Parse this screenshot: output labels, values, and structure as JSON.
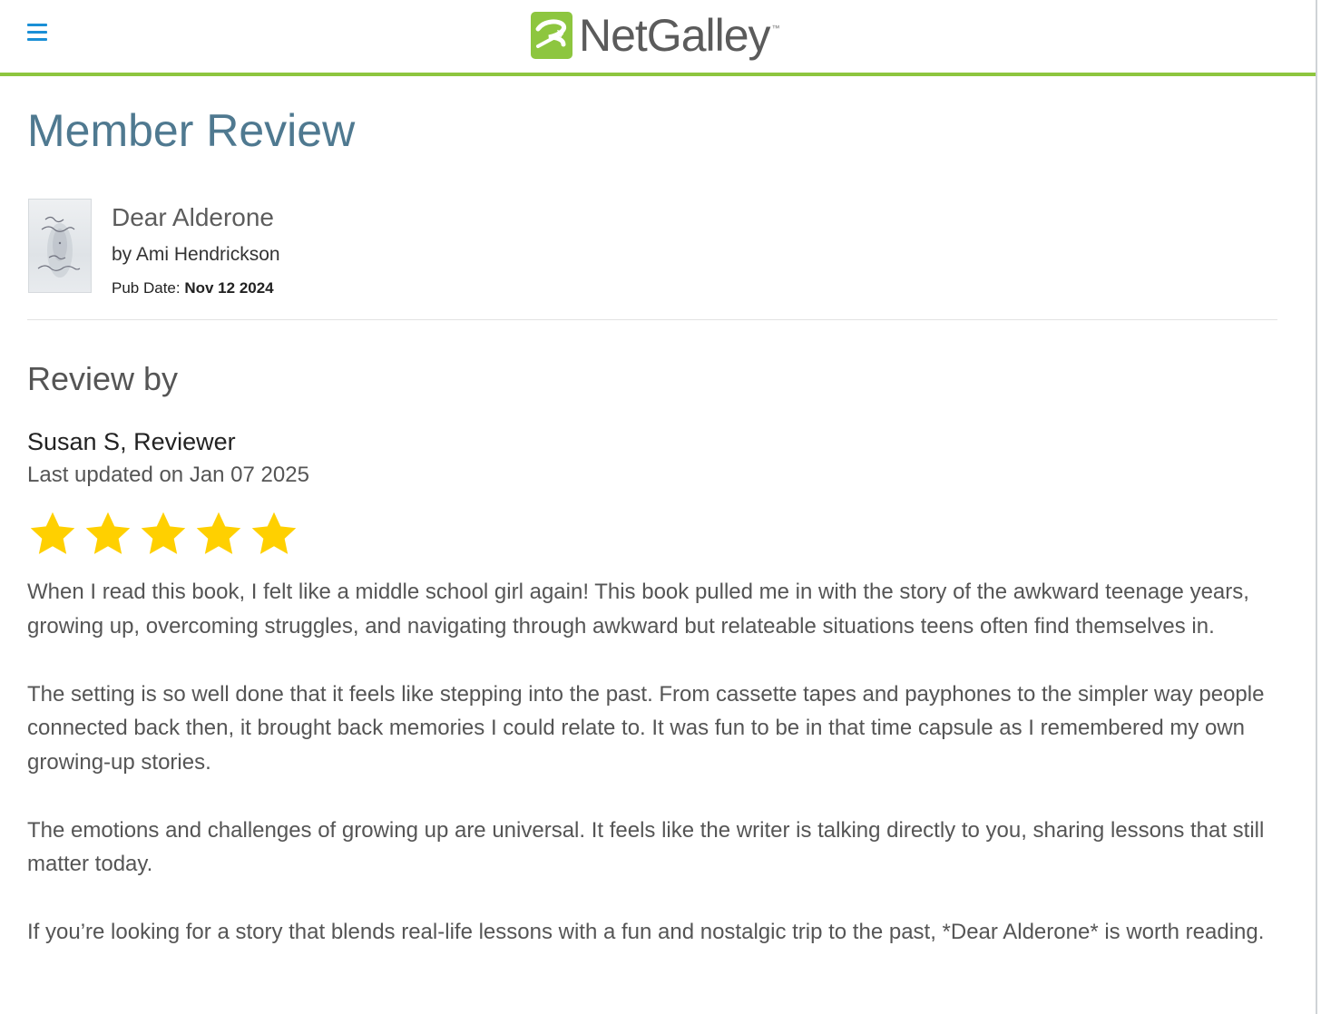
{
  "header": {
    "logo_text": "NetGalley",
    "logo_tm": "™",
    "brand_green": "#8dc63f",
    "menu_icon": "hamburger-menu-icon"
  },
  "page": {
    "title": "Member Review"
  },
  "book": {
    "title": "Dear Alderone",
    "author": "by Ami Hendrickson",
    "pub_date_label": "Pub Date:",
    "pub_date_value": "Nov 12 2024"
  },
  "review": {
    "heading": "Review by",
    "reviewer": "Susan S, Reviewer",
    "updated": "Last updated on Jan 07 2025",
    "rating": 5,
    "rating_max": 5,
    "star_color": "#ffd000",
    "paragraphs": [
      "When I read this book, I felt like a middle school girl again! This book pulled me in with the story of the awkward teenage years, growing up, overcoming struggles, and navigating through awkward but relateable situations teens often find themselves in.",
      "The setting is so well done that it feels like stepping into the past. From cassette tapes and payphones to the simpler way people connected back then, it brought back memories I could relate to. It was fun to be in that time capsule as I remembered my own growing-up stories.",
      "The emotions and challenges of growing up are universal. It feels like the writer is talking directly to you, sharing lessons that still matter today.",
      "If you’re looking for a story that blends real-life lessons with a fun and nostalgic trip to the past, *Dear Alderone* is worth reading."
    ]
  }
}
